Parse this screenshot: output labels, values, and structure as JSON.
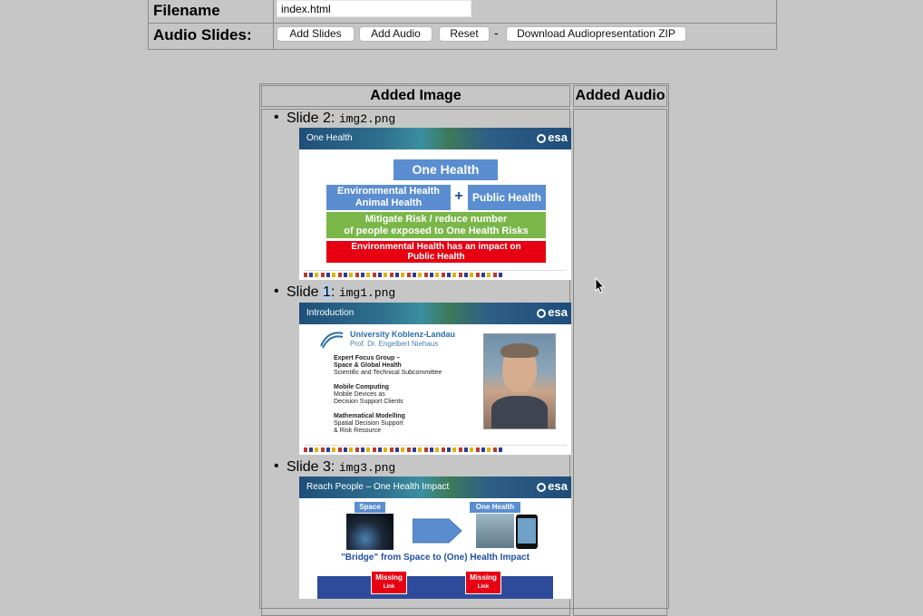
{
  "form": {
    "filename_label": "Filename",
    "filename_value": "index.html",
    "audio_label": "Audio Slides:",
    "add_slides": "Add Slides",
    "add_audio": "Add Audio",
    "reset": "Reset",
    "separator": "-",
    "download": "Download Audiopresentation ZIP"
  },
  "table": {
    "header_image": "Added Image",
    "header_audio": "Added Audio"
  },
  "slides": [
    {
      "prefix": "Slide 2",
      "number_highlight": "",
      "filename": "img2.png",
      "banner_title": "One Health",
      "content": {
        "top_box": "One Health",
        "left_box_1": "Environmental Health",
        "left_box_2": "Animal Health",
        "plus": "+",
        "right_box": "Public Health",
        "green_1": "Mitigate Risk / reduce number",
        "green_2": "of people exposed to One Health Risks",
        "red_1": "Environmental Health has an impact on",
        "red_2": "Public Health"
      }
    },
    {
      "prefix": "Slide ",
      "number_highlight": "1",
      "filename": "img1.png",
      "banner_title": "Introduction",
      "content": {
        "uni": "University Koblenz-Landau",
        "prof": "Prof. Dr. Engelbert Niehaus",
        "g1_t1": "Expert Focus Group –",
        "g1_t2": "Space & Global Health",
        "g1_d": "Scientific and Technical Subcommittee",
        "g2_t": "Mobile Computing",
        "g2_d1": "Mobile Devices as",
        "g2_d2": "Decision Support Clients",
        "g3_t": "Mathematical Modelling",
        "g3_d1": "Spatial Decision Support",
        "g3_d2": "& Risk Resource"
      }
    },
    {
      "prefix": "Slide 3",
      "number_highlight": "",
      "filename": "img3.png",
      "banner_title": "Reach People – One Health Impact",
      "content": {
        "space": "Space",
        "one_health": "One Health",
        "bridge": "\"Bridge\" from Space to (One) Health Impact",
        "missing": "Missing",
        "link": "Link"
      }
    }
  ],
  "icons": {
    "esa_logo": "esa",
    "cursor": "mouse-pointer-icon"
  },
  "colors": {
    "background": "#c6c6c6",
    "blue_box": "#5b8ed1",
    "green_box": "#7ab648",
    "red_box": "#e60012"
  }
}
